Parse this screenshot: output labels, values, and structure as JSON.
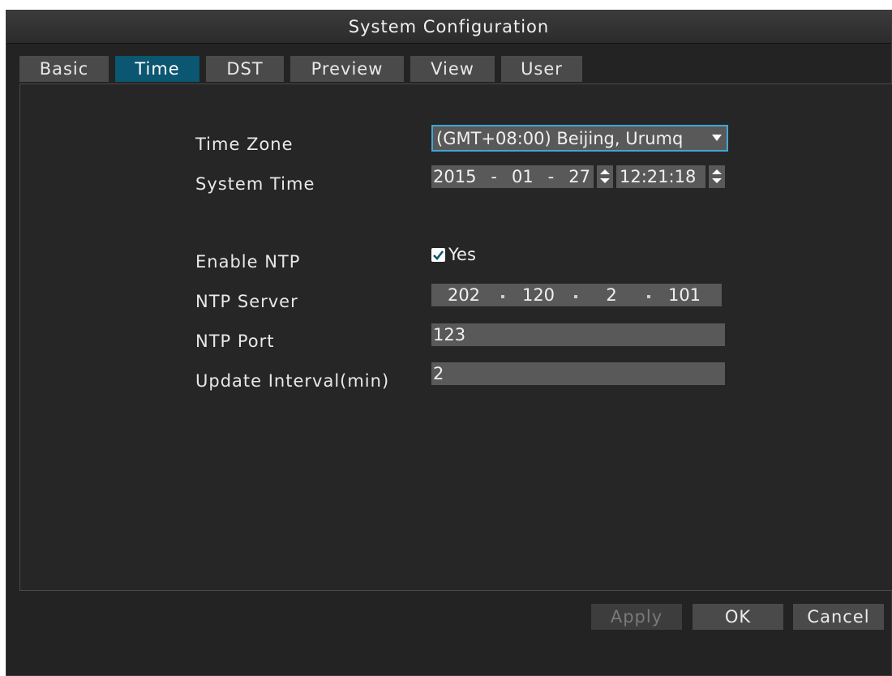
{
  "window": {
    "title": "System Configuration"
  },
  "tabs": [
    {
      "label": "Basic"
    },
    {
      "label": "Time",
      "active": true
    },
    {
      "label": "DST"
    },
    {
      "label": "Preview"
    },
    {
      "label": "View"
    },
    {
      "label": "User"
    }
  ],
  "form": {
    "time_zone": {
      "label": "Time Zone",
      "value": "(GMT+08:00) Beijing, Urumq"
    },
    "system_time": {
      "label": "System Time",
      "year": "2015",
      "month": "01",
      "day": "27",
      "time": "12:21:18"
    },
    "enable_ntp": {
      "label": "Enable NTP",
      "checked": true,
      "option_label": "Yes"
    },
    "ntp_server": {
      "label": "NTP Server",
      "octets": [
        "202",
        "120",
        "2",
        "101"
      ]
    },
    "ntp_port": {
      "label": "NTP Port",
      "value": "123"
    },
    "update_interval": {
      "label": "Update Interval(min)",
      "value": "2"
    }
  },
  "buttons": {
    "apply": "Apply",
    "ok": "OK",
    "cancel": "Cancel"
  },
  "colors": {
    "accent_tab": "#0b5670",
    "focus_border": "#3fa7d6",
    "field_bg": "#595959",
    "window_bg": "#232323"
  }
}
